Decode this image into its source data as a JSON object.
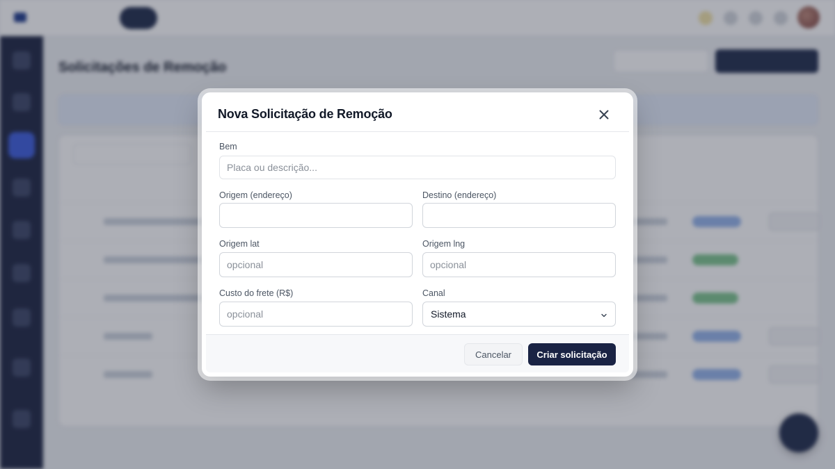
{
  "app": {
    "nav": [
      "",
      "",
      "",
      "",
      ""
    ],
    "page_title": "Solicitações de Remoção"
  },
  "modal": {
    "title": "Nova Solicitação de Remoção",
    "fields": {
      "bem": {
        "label": "Bem",
        "value": "",
        "placeholder": "Placa ou descrição..."
      },
      "origem": {
        "label": "Origem (endereço)",
        "value": "",
        "placeholder": ""
      },
      "destino": {
        "label": "Destino (endereço)",
        "value": "",
        "placeholder": ""
      },
      "origem_lat": {
        "label": "Origem lat",
        "value": "",
        "placeholder": "opcional"
      },
      "origem_lng": {
        "label": "Origem lng",
        "value": "",
        "placeholder": "opcional"
      },
      "custo_frete": {
        "label": "Custo do frete (R$)",
        "value": "",
        "placeholder": "opcional"
      },
      "canal": {
        "label": "Canal",
        "selected": "Sistema"
      }
    },
    "footer": {
      "cancel_label": "Cancelar",
      "submit_label": "Criar solicitação"
    }
  },
  "icons": {
    "close": "close-icon",
    "chevron": "chevron-down-icon"
  },
  "colors": {
    "primary": "#1a2344",
    "overlay": "rgba(40,46,62,0.38)"
  }
}
